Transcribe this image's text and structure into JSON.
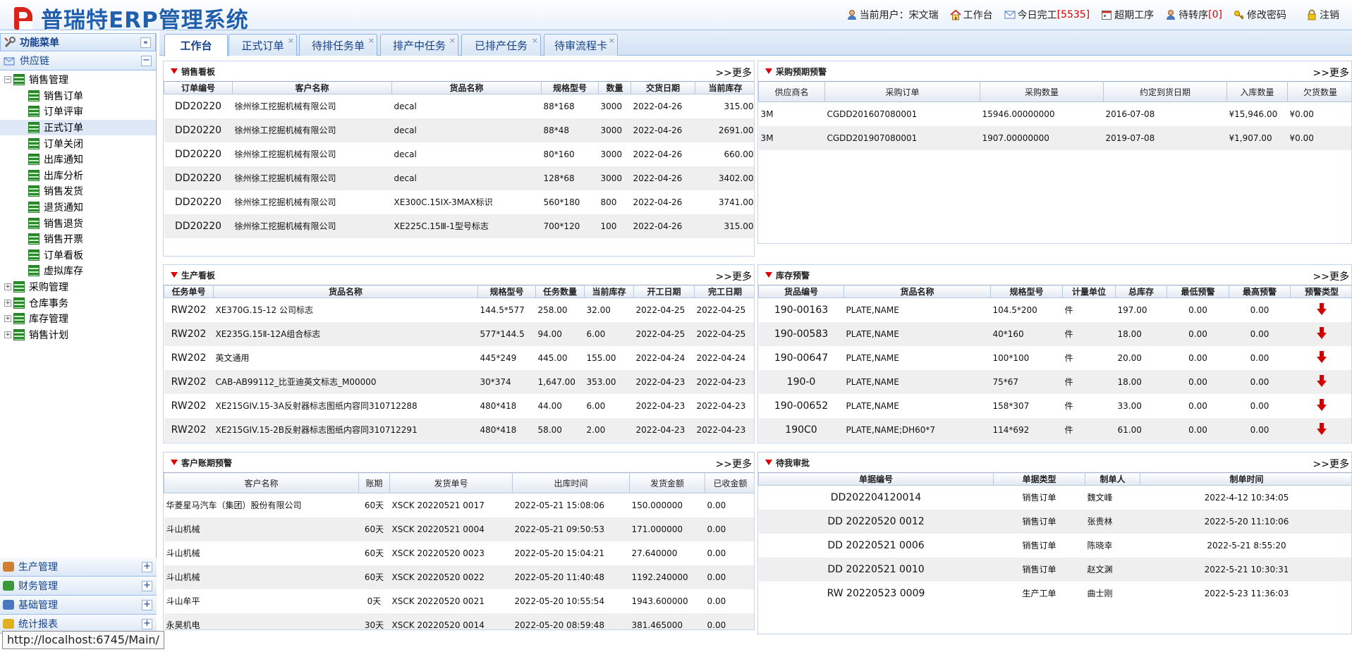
{
  "header": {
    "title": "普瑞特ERP管理系统",
    "current_user_label": "当前用户：",
    "current_user": "宋文瑞",
    "workbench": "工作台",
    "today_done_label": "今日完工",
    "today_done_count": "[5535]",
    "overdue": "超期工序",
    "pending_transfer_label": "待转序",
    "pending_transfer_count": "[0]",
    "change_password": "修改密码",
    "logout": "注销"
  },
  "sidebar": {
    "title": "功能菜单",
    "collapse_icon": "«",
    "group_supply": "供应链",
    "tree": [
      {
        "label": "销售管理",
        "level": 0,
        "exp": "−"
      },
      {
        "label": "销售订单",
        "level": 1
      },
      {
        "label": "订单评审",
        "level": 1
      },
      {
        "label": "正式订单",
        "level": 1,
        "selected": true
      },
      {
        "label": "订单关闭",
        "level": 1
      },
      {
        "label": "出库通知",
        "level": 1
      },
      {
        "label": "出库分析",
        "level": 1
      },
      {
        "label": "销售发货",
        "level": 1
      },
      {
        "label": "退货通知",
        "level": 1
      },
      {
        "label": "销售退货",
        "level": 1
      },
      {
        "label": "销售开票",
        "level": 1
      },
      {
        "label": "订单看板",
        "level": 1
      },
      {
        "label": "虚拟库存",
        "level": 1
      },
      {
        "label": "采购管理",
        "level": 0,
        "exp": "+"
      },
      {
        "label": "仓库事务",
        "level": 0,
        "exp": "+"
      },
      {
        "label": "库存管理",
        "level": 0,
        "exp": "+"
      },
      {
        "label": "销售计划",
        "level": 0,
        "exp": "+"
      }
    ],
    "bottom_groups": [
      "生产管理",
      "财务管理",
      "基础管理",
      "统计报表"
    ]
  },
  "tabs": [
    {
      "label": "工作台",
      "closable": false
    },
    {
      "label": "正式订单",
      "closable": true
    },
    {
      "label": "待排任务单",
      "closable": true
    },
    {
      "label": "排产中任务",
      "closable": true
    },
    {
      "label": "已排产任务",
      "closable": true
    },
    {
      "label": "待审流程卡",
      "closable": true
    }
  ],
  "more_label": ">>更多",
  "sales": {
    "title": "销售看板",
    "columns": [
      "订单编号",
      "客户名称",
      "货品名称",
      "规格型号",
      "数量",
      "交货日期",
      "当前库存"
    ],
    "rows": [
      [
        "DD20220",
        "徐州徐工挖掘机械有限公司",
        "decal",
        "88*168",
        "3000",
        "2022-04-26",
        "315.00"
      ],
      [
        "DD20220",
        "徐州徐工挖掘机械有限公司",
        "decal",
        "88*48",
        "3000",
        "2022-04-26",
        "2691.00"
      ],
      [
        "DD20220",
        "徐州徐工挖掘机械有限公司",
        "decal",
        "80*160",
        "3000",
        "2022-04-26",
        "660.00"
      ],
      [
        "DD20220",
        "徐州徐工挖掘机械有限公司",
        "decal",
        "128*68",
        "3000",
        "2022-04-26",
        "3402.00"
      ],
      [
        "DD20220",
        "徐州徐工挖掘机械有限公司",
        "XE300C.15IX-3MAX标识",
        "560*180",
        "800",
        "2022-04-26",
        "3741.00"
      ],
      [
        "DD20220",
        "徐州徐工挖掘机械有限公司",
        "XE225C.15Ⅲ-1型号标志",
        "700*120",
        "100",
        "2022-04-26",
        "315.00"
      ]
    ]
  },
  "purchase": {
    "title": "采购预期预警",
    "columns": [
      "供应商名",
      "采购订单",
      "采购数量",
      "约定到货日期",
      "入库数量",
      "欠货数量"
    ],
    "rows": [
      [
        "3M",
        "CGDD201607080001",
        "15946.00000000",
        "2016-07-08",
        "¥15,946.00",
        "¥0.00"
      ],
      [
        "3M",
        "CGDD201907080001",
        "1907.00000000",
        "2019-07-08",
        "¥1,907.00",
        "¥0.00"
      ]
    ]
  },
  "production": {
    "title": "生产看板",
    "columns": [
      "任务单号",
      "货品名称",
      "规格型号",
      "任务数量",
      "当前库存",
      "开工日期",
      "完工日期"
    ],
    "rows": [
      [
        "RW202",
        "XE370G.15-12 公司标志",
        "144.5*577",
        "258.00",
        "32.00",
        "2022-04-25",
        "2022-04-25"
      ],
      [
        "RW202",
        "XE235G.15Ⅱ-12A组合标志",
        "577*144.5",
        "94.00",
        "6.00",
        "2022-04-25",
        "2022-04-25"
      ],
      [
        "RW202",
        "英文通用",
        "445*249",
        "445.00",
        "155.00",
        "2022-04-24",
        "2022-04-24"
      ],
      [
        "RW202",
        "CAB-AB99112_比亚迪英文标志_M00000",
        "30*374",
        "1,647.00",
        "353.00",
        "2022-04-23",
        "2022-04-23"
      ],
      [
        "RW202",
        "XE215GIV.15-3A反射器标志图纸内容同310712288",
        "480*418",
        "44.00",
        "6.00",
        "2022-04-23",
        "2022-04-23"
      ],
      [
        "RW202",
        "XE215GIV.15-2B反射器标志图纸内容同310712291",
        "480*418",
        "58.00",
        "2.00",
        "2022-04-23",
        "2022-04-23"
      ]
    ]
  },
  "inventory": {
    "title": "库存预警",
    "columns": [
      "货品编号",
      "货品名称",
      "规格型号",
      "计量单位",
      "总库存",
      "最低预警",
      "最高预警",
      "预警类型"
    ],
    "rows": [
      [
        "190-00163",
        "PLATE,NAME",
        "104.5*200",
        "件",
        "197.00",
        "0.00",
        "0.00"
      ],
      [
        "190-00583",
        "PLATE,NAME",
        "40*160",
        "件",
        "18.00",
        "0.00",
        "0.00"
      ],
      [
        "190-00647",
        "PLATE,NAME",
        "100*100",
        "件",
        "20.00",
        "0.00",
        "0.00"
      ],
      [
        "190-0",
        "PLATE,NAME",
        "75*67",
        "件",
        "18.00",
        "0.00",
        "0.00"
      ],
      [
        "190-00652",
        "PLATE,NAME",
        "158*307",
        "件",
        "33.00",
        "0.00",
        "0.00"
      ],
      [
        "190C0",
        "PLATE,NAME;DH60*7",
        "114*692",
        "件",
        "61.00",
        "0.00",
        "0.00"
      ]
    ]
  },
  "receivable": {
    "title": "客户账期预警",
    "columns": [
      "客户名称",
      "账期",
      "发货单号",
      "出库时间",
      "发货金额",
      "已收金额"
    ],
    "rows": [
      [
        "华菱星马汽车（集团）股份有限公司",
        "60天",
        "XSCK 20220521 0017",
        "2022-05-21 15:08:06",
        "150.000000",
        "0.00"
      ],
      [
        "斗山机械",
        "60天",
        "XSCK 20220521 0004",
        "2022-05-21 09:50:53",
        "171.000000",
        "0.00"
      ],
      [
        "斗山机械",
        "60天",
        "XSCK 20220520 0023",
        "2022-05-20 15:04:21",
        "27.640000",
        "0.00"
      ],
      [
        "斗山机械",
        "60天",
        "XSCK 20220520 0022",
        "2022-05-20 11:40:48",
        "1192.240000",
        "0.00"
      ],
      [
        "斗山牟平",
        "0天",
        "XSCK 20220520 0021",
        "2022-05-20 10:55:54",
        "1943.600000",
        "0.00"
      ],
      [
        "永昊机电",
        "30天",
        "XSCK 20220520 0014",
        "2022-05-20 08:59:48",
        "381.465000",
        "0.00"
      ]
    ]
  },
  "approval": {
    "title": "待我审批",
    "columns": [
      "单据编号",
      "单据类型",
      "制单人",
      "制单时间"
    ],
    "rows": [
      [
        "DD202204120014",
        "销售订单",
        "魏文峰",
        "2022-4-12 10:34:05"
      ],
      [
        "DD 20220520 0012",
        "销售订单",
        "张贵林",
        "2022-5-20 11:10:06"
      ],
      [
        "DD 20220521 0006",
        "销售订单",
        "陈晓幸",
        "2022-5-21 8:55:20"
      ],
      [
        "DD 20220521 0010",
        "销售订单",
        "赵文渊",
        "2022-5-21 10:30:31"
      ],
      [
        "RW 20220523 0009",
        "生产工单",
        "曲士刚",
        "2022-5-23 11:36:03"
      ]
    ]
  },
  "statusbar": "http://localhost:6745/Main/"
}
